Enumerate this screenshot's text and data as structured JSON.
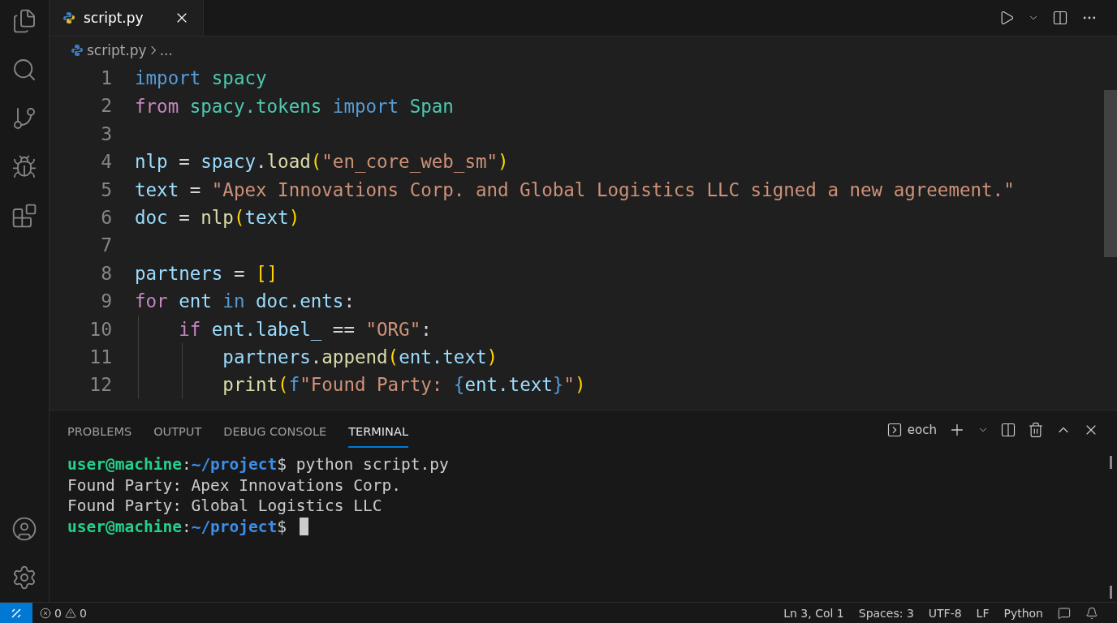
{
  "tabs": [
    {
      "label": "script.py",
      "selected": true
    }
  ],
  "breadcrumb": {
    "file": "script.py",
    "more": "..."
  },
  "editor": {
    "lines": [
      {
        "number": "1",
        "tokens": [
          {
            "kind": "kw",
            "text": "import"
          },
          {
            "kind": "mod",
            "text": " spacy"
          }
        ]
      },
      {
        "number": "2",
        "tokens": [
          {
            "kind": "ctrl",
            "text": "from"
          },
          {
            "kind": "mod",
            "text": " spacy.tokens"
          },
          {
            "kind": "kw",
            "text": " import"
          },
          {
            "kind": "mod",
            "text": " Span"
          }
        ]
      },
      {
        "number": "3"
      },
      {
        "number": "4",
        "tokens": [
          {
            "kind": "var",
            "text": "nlp"
          },
          {
            "kind": "op",
            "text": " = "
          },
          {
            "kind": "var",
            "text": "spacy"
          },
          {
            "kind": "op",
            "text": "."
          },
          {
            "kind": "fn",
            "text": "load"
          },
          {
            "kind": "br",
            "text": "("
          },
          {
            "kind": "str",
            "text": "\"en_core_web_sm\""
          },
          {
            "kind": "br",
            "text": ")"
          }
        ]
      },
      {
        "number": "5",
        "tokens": [
          {
            "kind": "var",
            "text": "text"
          },
          {
            "kind": "op",
            "text": " = "
          },
          {
            "kind": "str",
            "text": "\"Apex Innovations Corp. and Global Logistics LLC signed a new agreement.\""
          }
        ]
      },
      {
        "number": "6",
        "tokens": [
          {
            "kind": "var",
            "text": "doc"
          },
          {
            "kind": "op",
            "text": " = "
          },
          {
            "kind": "fn",
            "text": "nlp"
          },
          {
            "kind": "br",
            "text": "("
          },
          {
            "kind": "var",
            "text": "text"
          },
          {
            "kind": "br",
            "text": ")"
          }
        ]
      },
      {
        "number": "7"
      },
      {
        "number": "8",
        "tokens": [
          {
            "kind": "var",
            "text": "partners"
          },
          {
            "kind": "op",
            "text": " = "
          },
          {
            "kind": "br",
            "text": "[]"
          }
        ]
      },
      {
        "number": "9",
        "tokens": [
          {
            "kind": "ctrl",
            "text": "for"
          },
          {
            "kind": "var",
            "text": " ent"
          },
          {
            "kind": "kw",
            "text": " in"
          },
          {
            "kind": "var",
            "text": " doc.ents"
          },
          {
            "kind": "op",
            "text": ":"
          }
        ]
      },
      {
        "number": "10",
        "tokens": [
          {
            "kind": "ctrl",
            "text": "    if"
          },
          {
            "kind": "var",
            "text": " ent.label_"
          },
          {
            "kind": "op",
            "text": " == "
          },
          {
            "kind": "str",
            "text": "\"ORG\""
          },
          {
            "kind": "op",
            "text": ":"
          }
        ]
      },
      {
        "number": "11",
        "tokens": [
          {
            "kind": "var",
            "text": "        partners"
          },
          {
            "kind": "op",
            "text": "."
          },
          {
            "kind": "fn",
            "text": "append"
          },
          {
            "kind": "br",
            "text": "("
          },
          {
            "kind": "var",
            "text": "ent.text"
          },
          {
            "kind": "br",
            "text": ")"
          }
        ]
      },
      {
        "number": "12",
        "tokens": [
          {
            "kind": "fn",
            "text": "        print"
          },
          {
            "kind": "br",
            "text": "("
          },
          {
            "kind": "kw",
            "text": "f"
          },
          {
            "kind": "str",
            "text": "\"Found Party: "
          },
          {
            "kind": "kw",
            "text": "{"
          },
          {
            "kind": "var",
            "text": "ent.text"
          },
          {
            "kind": "kw",
            "text": "}"
          },
          {
            "kind": "str",
            "text": "\""
          },
          {
            "kind": "br",
            "text": ")"
          }
        ]
      }
    ]
  },
  "panel": {
    "tabs": [
      {
        "label": "PROBLEMS",
        "selected": false
      },
      {
        "label": "OUTPUT",
        "selected": false
      },
      {
        "label": "DEBUG CONSOLE",
        "selected": false
      },
      {
        "label": "TERMINAL",
        "selected": true
      }
    ],
    "terminal_name": "eoch",
    "lines": [
      {
        "kind": "prompt",
        "user": "user@machine",
        "separator": ":",
        "path": "~/project",
        "sign": "$",
        "command": "python script.py"
      },
      {
        "kind": "output",
        "text": "Found Party: Apex Innovations Corp."
      },
      {
        "kind": "output",
        "text": "Found Party: Global Logistics LLC"
      },
      {
        "kind": "prompt",
        "user": "user@machine",
        "separator": ":",
        "path": "~/project",
        "sign": "$"
      }
    ]
  },
  "status_bar": {
    "errors": "0",
    "warnings": "0",
    "items": [
      "Ln 3, Col 1",
      "Spaces: 3",
      "UTF-8",
      "LF",
      "Python"
    ]
  }
}
